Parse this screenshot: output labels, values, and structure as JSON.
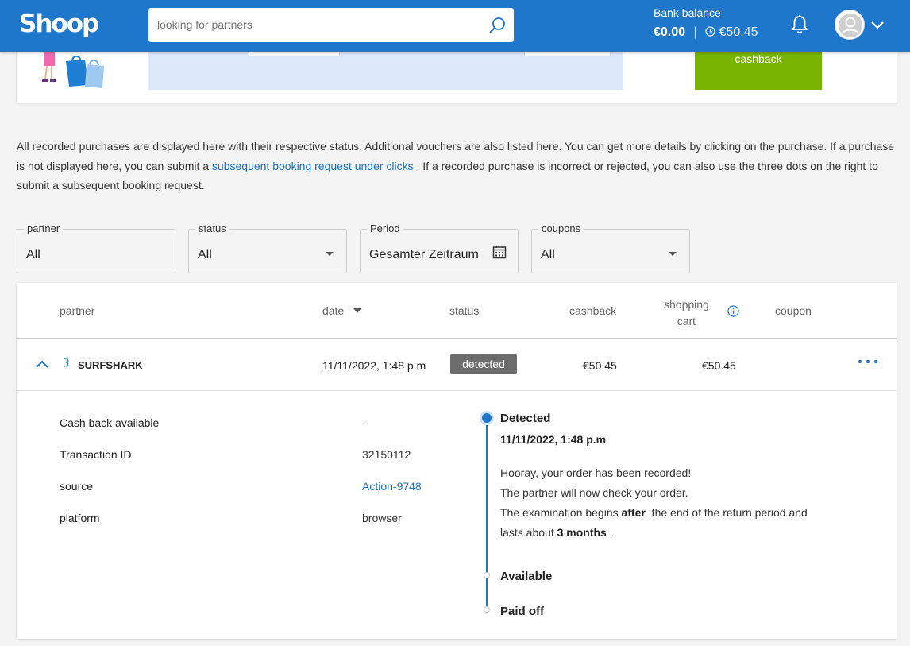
{
  "header": {
    "logo": "Shoop",
    "search_placeholder": "looking for partners",
    "bank_label": "Bank balance",
    "bank_balance": "€0.00",
    "bank_separator": "|",
    "bank_pending": "€50.45"
  },
  "top_card": {
    "green_button_label": "cashback"
  },
  "intro": {
    "text_before": "All recorded purchases are displayed here with their respective status. Additional vouchers are also listed here. You can get more details by clicking on the purchase. If a purchase is not displayed here, you can submit a ",
    "link": "subsequent booking request under clicks",
    "text_after": " . If a recorded purchase is incorrect or rejected, you can also use the three dots on the right to submit a subsequent booking request."
  },
  "filters": {
    "partner": {
      "label": "partner",
      "value": "All"
    },
    "status": {
      "label": "status",
      "value": "All"
    },
    "period": {
      "label": "Period",
      "value": "Gesamter Zeitraum"
    },
    "coupons": {
      "label": "coupons",
      "value": "All"
    }
  },
  "table": {
    "columns": {
      "partner": "partner",
      "date": "date",
      "status": "status",
      "cashback": "cashback",
      "cart_line1": "shopping",
      "cart_line2": "cart",
      "coupon": "coupon"
    },
    "row": {
      "partner": "SURFSHARK",
      "date": "11/11/2022, 1:48 p.m",
      "status": "detected",
      "cashback": "€50.45",
      "cart": "€50.45"
    },
    "details": {
      "cashback_available_label": "Cash back available",
      "cashback_available_value": "-",
      "transaction_id_label": "Transaction ID",
      "transaction_id_value": "32150112",
      "source_label": "source",
      "source_value": "Action-9748",
      "platform_label": "platform",
      "platform_value": "browser"
    },
    "timeline": {
      "detected_title": "Detected",
      "detected_date": "11/11/2022, 1:48 p.m",
      "line1": "Hooray, your order has been recorded!",
      "line2": "The partner will now check your order.",
      "line3_pre": "The examination begins ",
      "line3_bold": "after",
      "line3_post": "  the end of the return period and",
      "line4_pre": "lasts about ",
      "line4_bold": "3 months",
      "line4_post": " .",
      "available_title": "Available",
      "paid_title": "Paid off"
    }
  },
  "colors": {
    "brand_blue": "#1f77cc",
    "green": "#78b400",
    "badge_grey": "#6d6d6d",
    "link_blue": "#1f6fbf"
  }
}
